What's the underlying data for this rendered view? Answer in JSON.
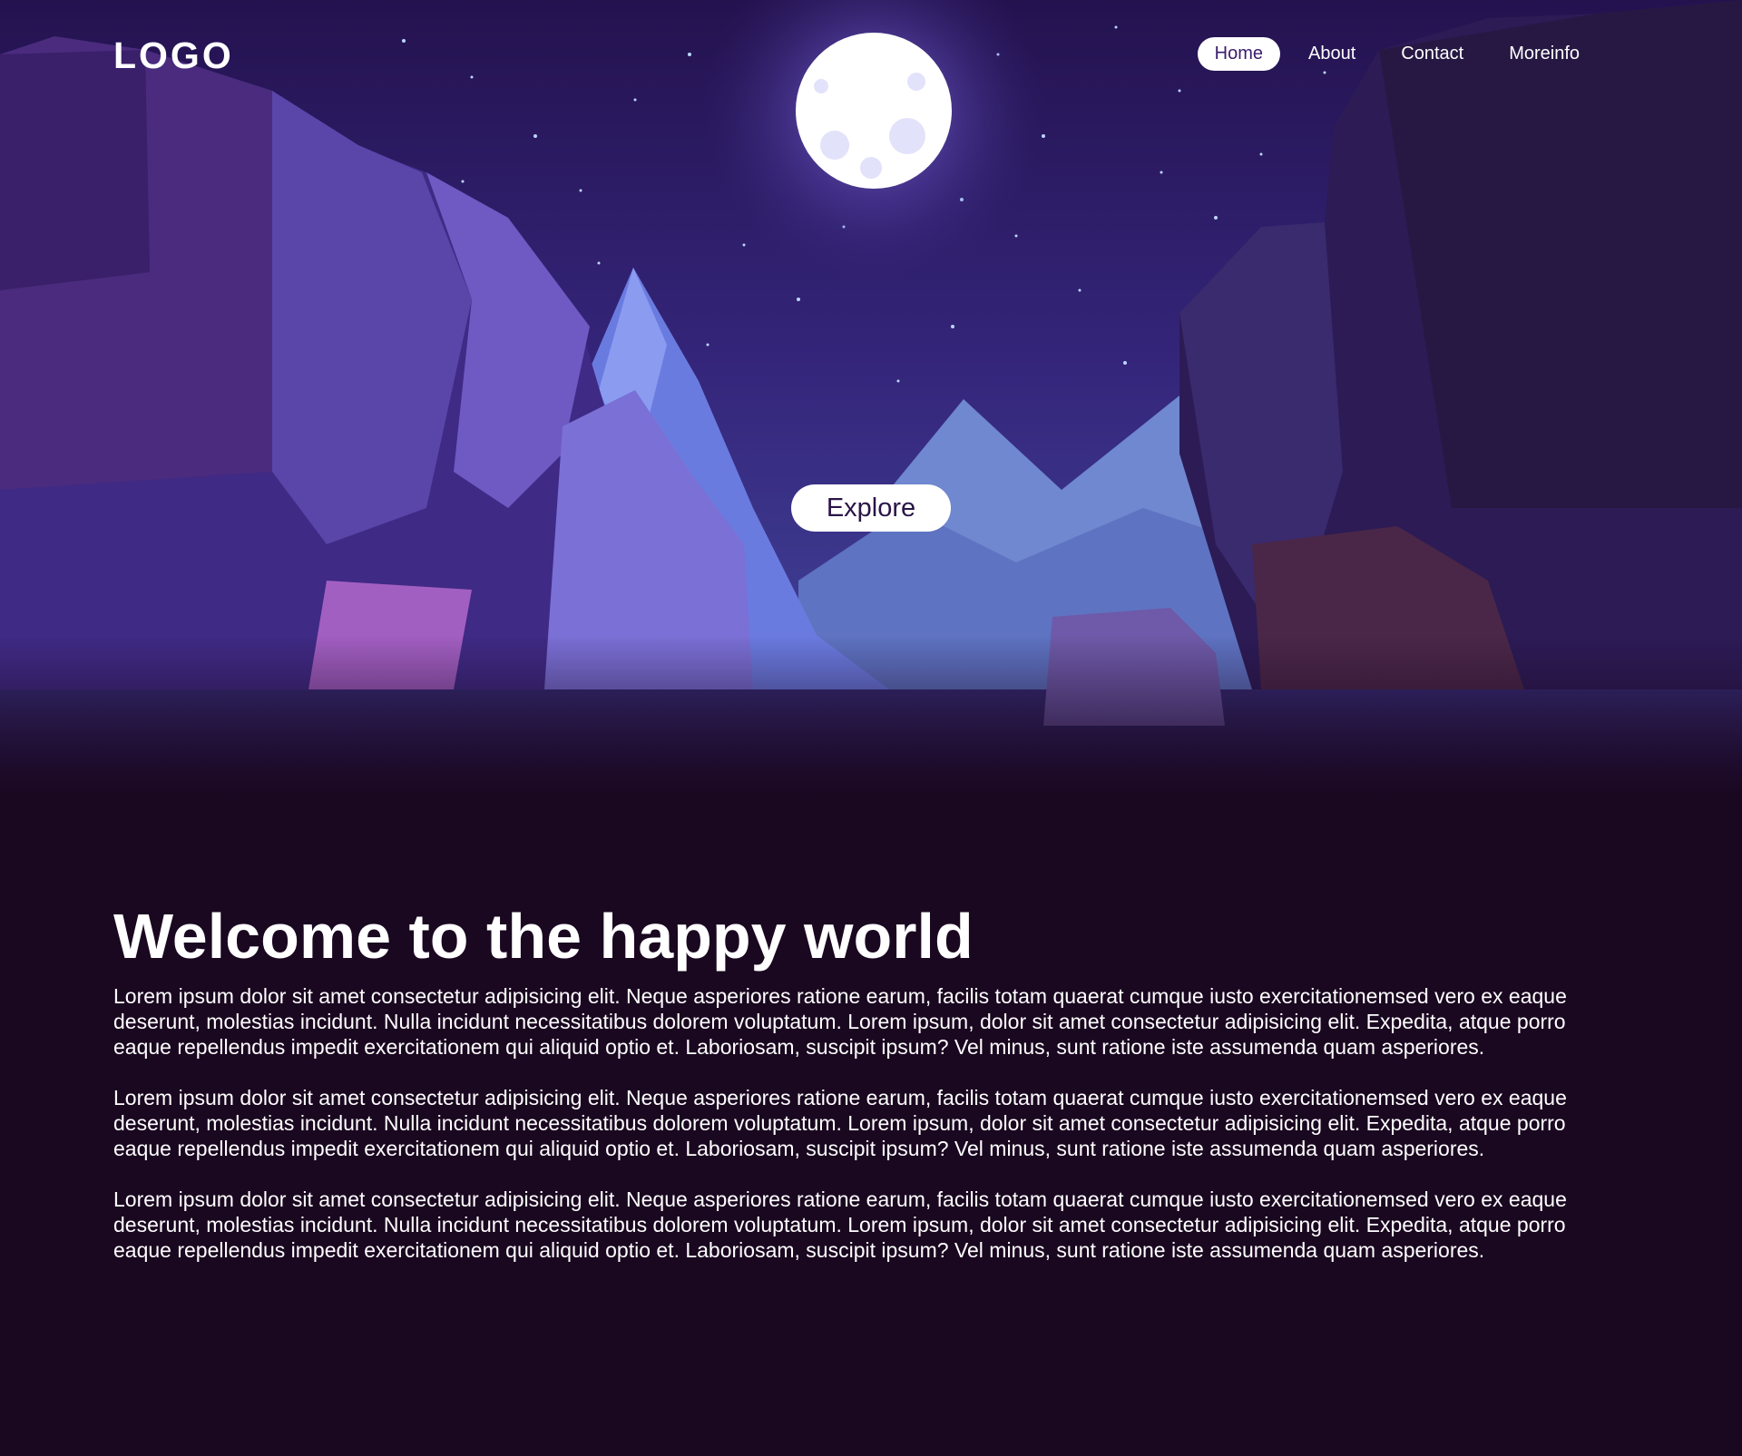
{
  "header": {
    "logo": "LOGO",
    "nav": [
      {
        "label": "Home",
        "active": true
      },
      {
        "label": "About",
        "active": false
      },
      {
        "label": "Contact",
        "active": false
      },
      {
        "label": "Moreinfo",
        "active": false
      }
    ]
  },
  "hero": {
    "explore_label": "Explore"
  },
  "main": {
    "title": "Welcome to the happy world",
    "paragraphs": [
      "Lorem ipsum dolor sit amet consectetur adipisicing elit. Neque asperiores ratione earum, facilis totam quaerat cumque iusto exercitationemsed vero ex eaque deserunt, molestias incidunt. Nulla incidunt necessitatibus dolorem voluptatum. Lorem ipsum, dolor sit amet consectetur adipisicing elit. Expedita, atque porro eaque repellendus impedit exercitationem qui aliquid optio et. Laboriosam, suscipit ipsum? Vel minus, sunt ratione iste assumenda quam asperiores.",
      "Lorem ipsum dolor sit amet consectetur adipisicing elit. Neque asperiores ratione earum, facilis totam quaerat cumque iusto exercitationemsed vero ex eaque deserunt, molestias incidunt. Nulla incidunt necessitatibus dolorem voluptatum. Lorem ipsum, dolor sit amet consectetur adipisicing elit. Expedita, atque porro eaque repellendus impedit exercitationem qui aliquid optio et. Laboriosam, suscipit ipsum? Vel minus, sunt ratione iste assumenda quam asperiores.",
      "Lorem ipsum dolor sit amet consectetur adipisicing elit. Neque asperiores ratione earum, facilis totam quaerat cumque iusto exercitationemsed vero ex eaque deserunt, molestias incidunt. Nulla incidunt necessitatibus dolorem voluptatum. Lorem ipsum, dolor sit amet consectetur adipisicing elit. Expedita, atque porro eaque repellendus impedit exercitationem qui aliquid optio et. Laboriosam, suscipit ipsum? Vel minus, sunt ratione iste assumenda quam asperiores."
    ]
  },
  "colors": {
    "page_bg": "#1a0720",
    "sky_top": "#2a1558",
    "accent_text": "#3a1b6e"
  }
}
